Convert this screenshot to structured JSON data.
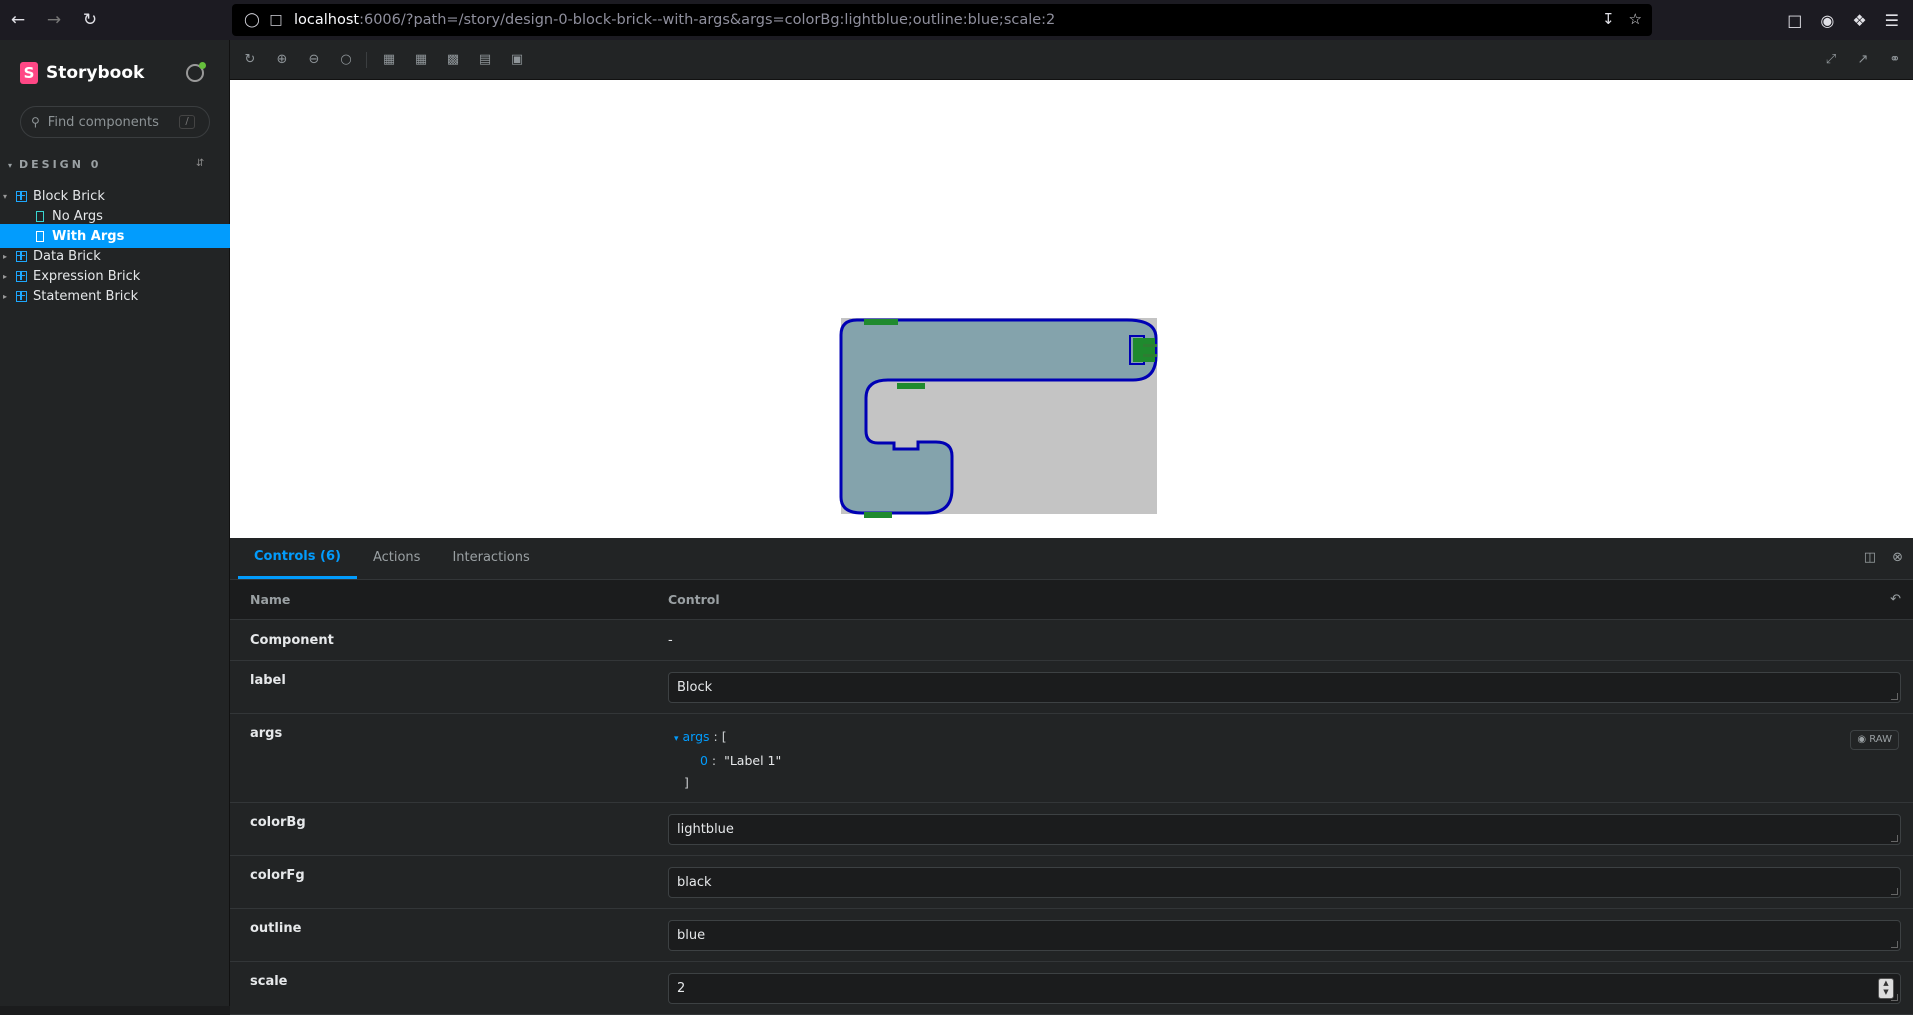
{
  "browser": {
    "url_host": "localhost",
    "url_rest": ":6006/?path=/story/design-0-block-brick--with-args&args=colorBg:lightblue;outline:blue;scale:2"
  },
  "sidebar": {
    "brand": "Storybook",
    "search_placeholder": "Find components",
    "search_shortcut": "/",
    "group": "DESIGN 0",
    "items": [
      {
        "label": "Block Brick",
        "type": "component",
        "expanded": true
      },
      {
        "label": "No Args",
        "type": "story"
      },
      {
        "label": "With Args",
        "type": "story",
        "active": true
      },
      {
        "label": "Data Brick",
        "type": "component"
      },
      {
        "label": "Expression Brick",
        "type": "component"
      },
      {
        "label": "Statement Brick",
        "type": "component"
      }
    ]
  },
  "panel": {
    "tabs": [
      "Controls (6)",
      "Actions",
      "Interactions"
    ],
    "header": {
      "name": "Name",
      "control": "Control"
    },
    "component_row": {
      "name": "Component",
      "value": "-"
    },
    "rows": {
      "label": {
        "name": "label",
        "value": "Block"
      },
      "args": {
        "name": "args",
        "key": "args",
        "open": "[",
        "index": "0",
        "item": "\"Label 1\"",
        "close": "]",
        "raw": "RAW"
      },
      "colorBg": {
        "name": "colorBg",
        "value": "lightblue"
      },
      "colorFg": {
        "name": "colorFg",
        "value": "black"
      },
      "outline": {
        "name": "outline",
        "value": "blue"
      },
      "scale": {
        "name": "scale",
        "value": "2"
      }
    }
  },
  "colors": {
    "accent": "#029cfd",
    "brand": "#ff4785",
    "brick_bg": "#84a3ac",
    "brick_outline": "#0000b4",
    "brick_connector": "#1f8a2e",
    "preview_bg": "#c4c4c4"
  }
}
